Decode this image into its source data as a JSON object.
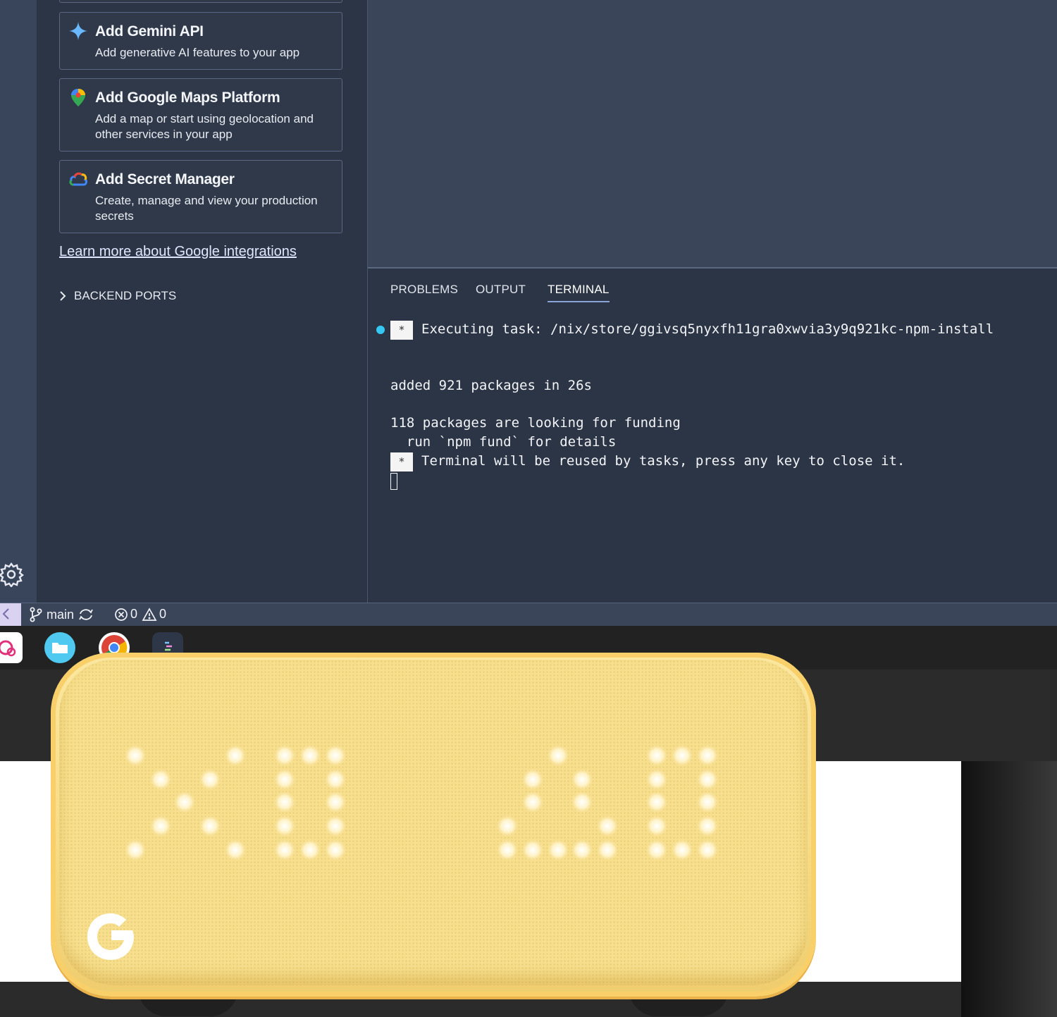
{
  "sidebar": {
    "cards": [
      {
        "title": "Add Gemini API",
        "desc": "Add generative AI features to your app",
        "icon": "sparkle-icon"
      },
      {
        "title": "Add Google Maps Platform",
        "desc": "Add a map or start using geolocation and other services in your app",
        "icon": "map-pin-icon"
      },
      {
        "title": "Add Secret Manager",
        "desc": "Create, manage and view your production secrets",
        "icon": "cloud-icon"
      }
    ],
    "learn_more": "Learn more about Google integrations",
    "backend_ports": "BACKEND PORTS"
  },
  "panel": {
    "tabs": [
      "PROBLEMS",
      "OUTPUT",
      "TERMINAL"
    ],
    "active_tab": "TERMINAL",
    "terminal": {
      "star": "*",
      "line1": "Executing task: /nix/store/ggivsq5nyxfh11gra0xwvia3y9q921kc-npm-install",
      "line2": "added 921 packages in 26s",
      "line3": "118 packages are looking for funding",
      "line4": "  run `npm fund` for details",
      "line5": "Terminal will be reused by tasks, press any key to close it."
    }
  },
  "statusbar": {
    "branch": "main",
    "errors": "0",
    "warnings": "0"
  },
  "colors": {
    "accent": "#35c8f2",
    "clock_body": "#f7df8d",
    "led": "#fff6da"
  }
}
